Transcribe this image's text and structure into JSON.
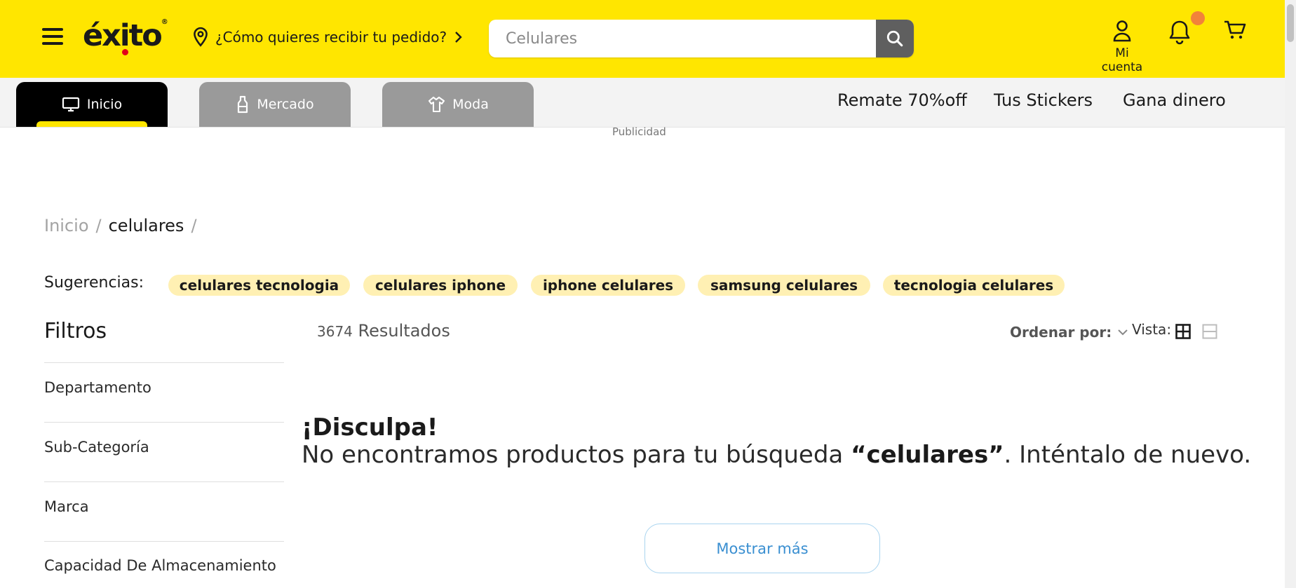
{
  "header": {
    "logo_text": "éxito",
    "logo_reg": "®",
    "delivery_text": "¿Cómo quieres recibir tu pedido?",
    "search": {
      "placeholder": "Celulares"
    },
    "account_label": "Mi cuenta",
    "brand_color": "#FFE600",
    "icons": [
      "menu-icon",
      "location-pin-icon",
      "chevron-right-icon",
      "search-icon",
      "user-icon",
      "bell-icon",
      "cart-icon"
    ]
  },
  "nav": {
    "tabs": [
      {
        "label": "Inicio",
        "icon": "monitor-icon",
        "active": true
      },
      {
        "label": "Mercado",
        "icon": "bottle-icon",
        "active": false
      },
      {
        "label": "Moda",
        "icon": "shirt-icon",
        "active": false
      }
    ],
    "links": [
      "Remate 70%off",
      "Tus Stickers",
      "Gana dinero"
    ]
  },
  "ad_label": "Publicidad",
  "breadcrumb": {
    "items": [
      "Inicio",
      "celulares"
    ],
    "separator": "/"
  },
  "suggestions": {
    "label": "Sugerencias:",
    "chips": [
      "celulares tecnologia",
      "celulares iphone",
      "iphone celulares",
      "samsung celulares",
      "tecnologia celulares"
    ]
  },
  "filters": {
    "title": "Filtros",
    "items": [
      "Departamento",
      "Sub-Categoría",
      "Marca",
      "Capacidad De Almacenamiento"
    ]
  },
  "results": {
    "count": "3674",
    "label": "Resultados",
    "sort_label": "Ordenar por:",
    "view_label": "Vista:"
  },
  "empty_state": {
    "title": "¡Disculpa!",
    "message_prefix": "No encontramos productos para tu búsqueda ",
    "query": "“celulares”",
    "message_suffix": ". Inténtalo de nuevo."
  },
  "show_more_label": "Mostrar más"
}
